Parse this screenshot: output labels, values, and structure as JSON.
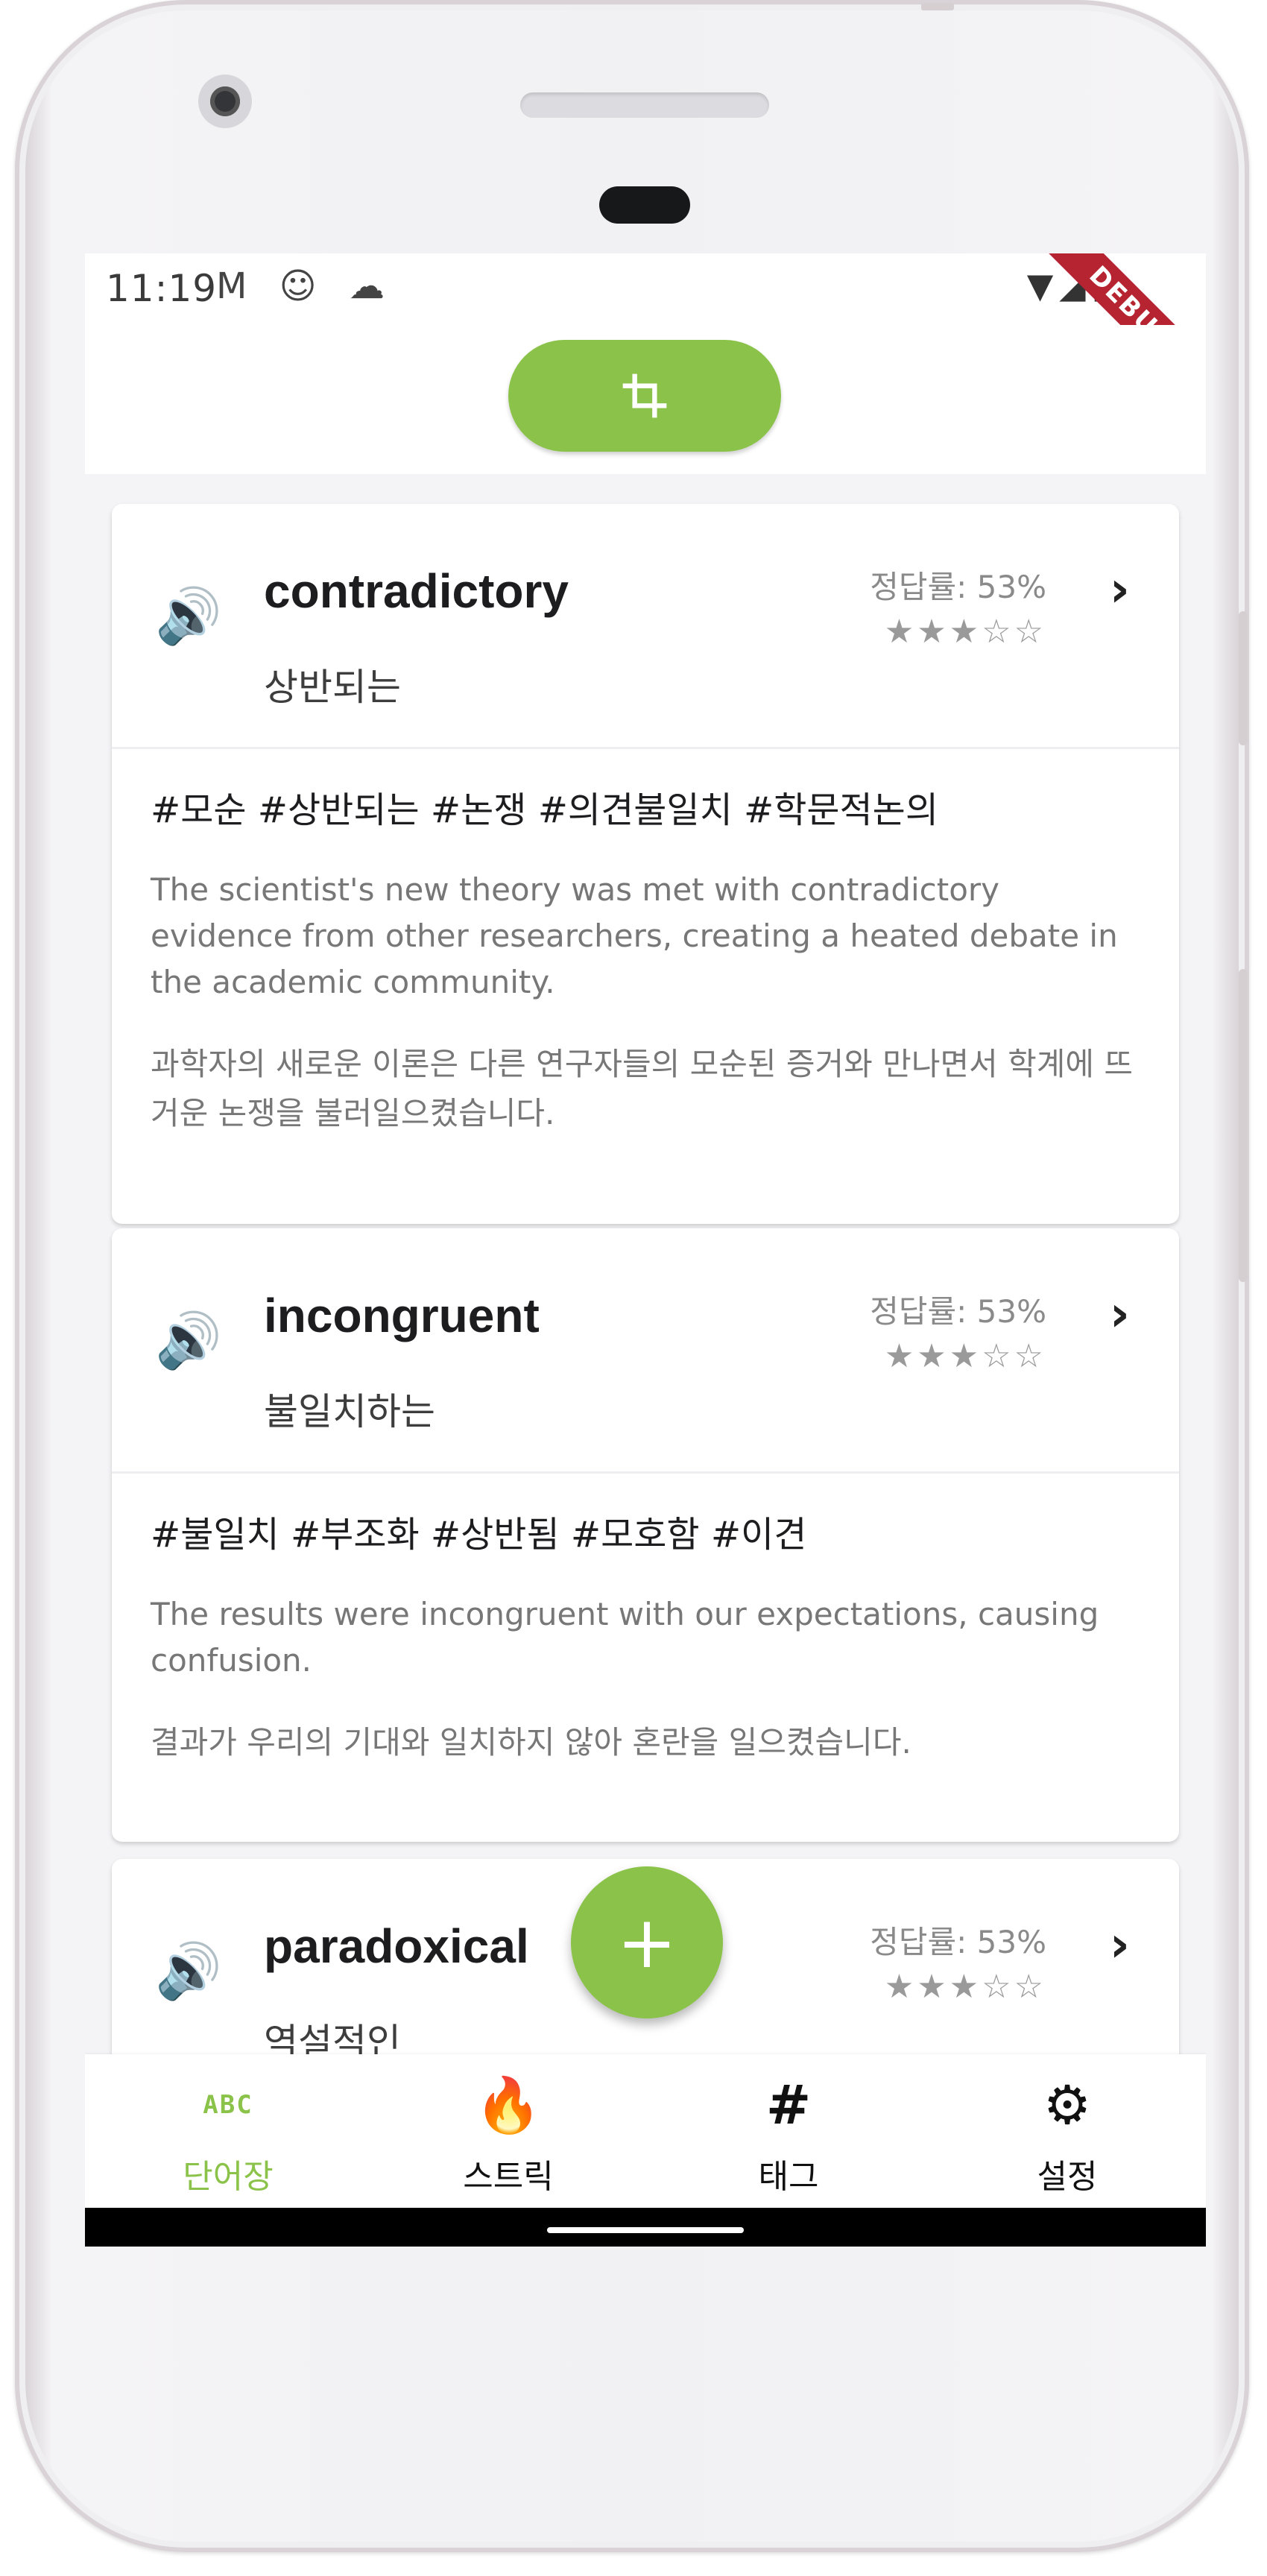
{
  "status": {
    "time": "11:19",
    "left_icons": "M ☺ ☁",
    "right_icons": "▼◢▮",
    "debug_label": "DEBUG"
  },
  "appbar": {
    "crop_icon": "crop-icon"
  },
  "cards": [
    {
      "word": "contradictory",
      "meaning": "상반되는",
      "rate": "정답률: 53%",
      "stars": "★★★☆☆",
      "tags": "#모순 #상반되는 #논쟁 #의견불일치 #학문적논의",
      "example_en": "The scientist's new theory was met with contradictory evidence from other researchers, creating a heated debate in the academic community.",
      "example_ko": "과학자의 새로운 이론은 다른 연구자들의 모순된 증거와 만나면서 학계에 뜨거운 논쟁을 불러일으켰습니다."
    },
    {
      "word": "incongruent",
      "meaning": "불일치하는",
      "rate": "정답률: 53%",
      "stars": "★★★☆☆",
      "tags": "#불일치 #부조화 #상반됨 #모호함 #이견",
      "example_en": "The results were incongruent with our expectations, causing confusion.",
      "example_ko": "결과가 우리의 기대와 일치하지 않아 혼란을 일으켰습니다."
    },
    {
      "word": "paradoxical",
      "meaning": "역설적인",
      "rate": "정답률: 53%",
      "stars": "★★★☆☆"
    }
  ],
  "fab": {
    "label": "+"
  },
  "nav": [
    {
      "label": "단어장",
      "icon": "ABC"
    },
    {
      "label": "스트릭",
      "icon": "🔥"
    },
    {
      "label": "태그",
      "icon": "#"
    },
    {
      "label": "설정",
      "icon": "⚙"
    }
  ],
  "colors": {
    "accent": "#8bc34a",
    "debug": "#b52430"
  }
}
